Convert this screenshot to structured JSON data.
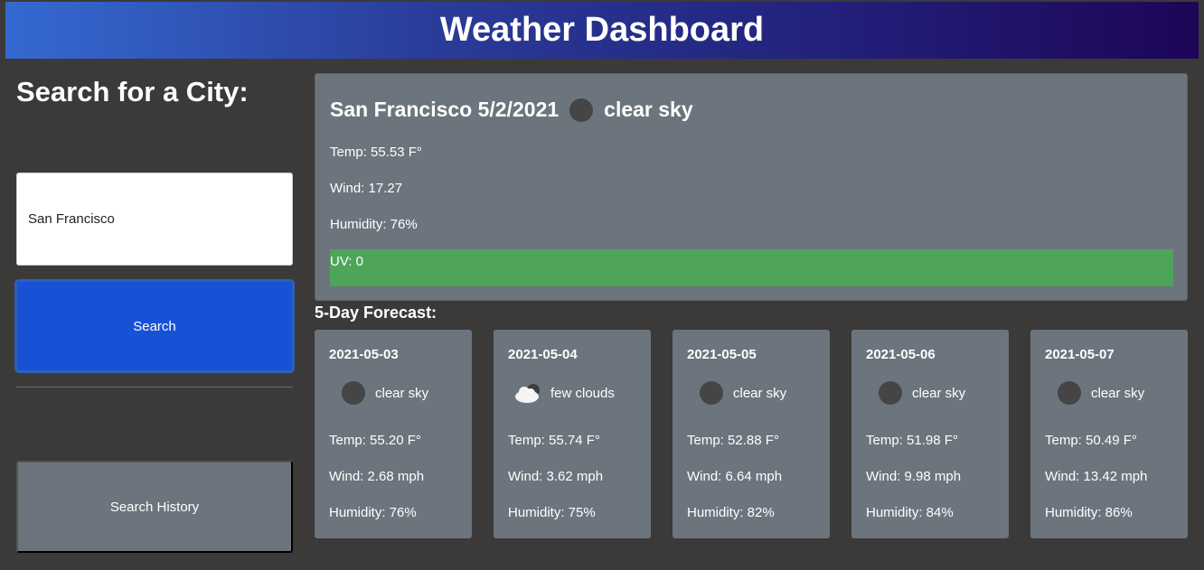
{
  "header": {
    "title": "Weather Dashboard"
  },
  "sidebar": {
    "heading": "Search for a City:",
    "input_value": "San Francisco",
    "search_label": "Search",
    "history_label": "Search History"
  },
  "current": {
    "city_date": "San Francisco 5/2/2021",
    "icon": "moon-icon",
    "condition": "clear sky",
    "temp": "Temp: 55.53 F°",
    "wind": "Wind: 17.27",
    "humidity": "Humidity: 76%",
    "uv": "UV: 0",
    "uv_color": "#4ea55a"
  },
  "forecast": {
    "title": "5-Day Forecast:",
    "days": [
      {
        "date": "2021-05-03",
        "icon": "moon-icon",
        "condition": "clear sky",
        "temp": "Temp: 55.20 F°",
        "wind": "Wind: 2.68 mph",
        "humidity": "Humidity: 76%"
      },
      {
        "date": "2021-05-04",
        "icon": "cloud-icon",
        "condition": "few clouds",
        "temp": "Temp: 55.74 F°",
        "wind": "Wind: 3.62 mph",
        "humidity": "Humidity: 75%"
      },
      {
        "date": "2021-05-05",
        "icon": "moon-icon",
        "condition": "clear sky",
        "temp": "Temp: 52.88 F°",
        "wind": "Wind: 6.64 mph",
        "humidity": "Humidity: 82%"
      },
      {
        "date": "2021-05-06",
        "icon": "moon-icon",
        "condition": "clear sky",
        "temp": "Temp: 51.98 F°",
        "wind": "Wind: 9.98 mph",
        "humidity": "Humidity: 84%"
      },
      {
        "date": "2021-05-07",
        "icon": "moon-icon",
        "condition": "clear sky",
        "temp": "Temp: 50.49 F°",
        "wind": "Wind: 13.42 mph",
        "humidity": "Humidity: 86%"
      }
    ]
  },
  "colors": {
    "header_start": "#3569d1",
    "header_end": "#1e0557",
    "search_button": "#1752d6",
    "card_bg": "#6c757d",
    "page_bg": "#3b3a39"
  }
}
